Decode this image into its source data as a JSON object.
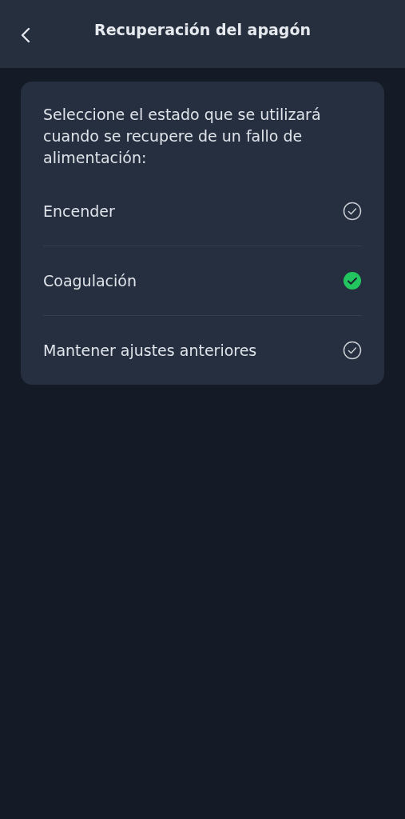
{
  "header": {
    "title": "Recuperación del apagón"
  },
  "card": {
    "description": "Seleccione el estado que se utilizará cuando se recupere de un fallo de alimentación:",
    "options": [
      {
        "label": "Encender",
        "selected": false
      },
      {
        "label": "Coagulación",
        "selected": true
      },
      {
        "label": "Mantener ajustes anteriores",
        "selected": false
      }
    ]
  }
}
